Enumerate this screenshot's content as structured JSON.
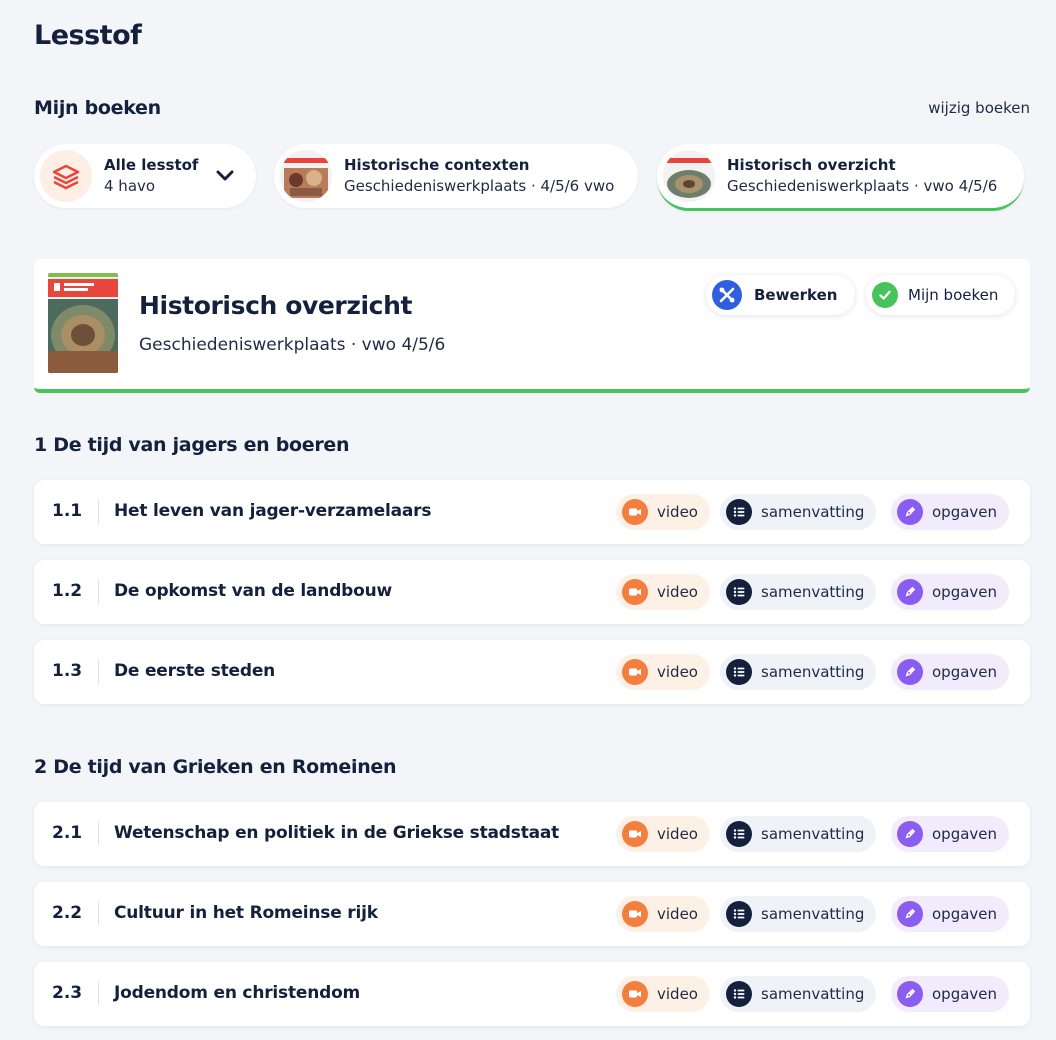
{
  "page": {
    "title": "Lesstof"
  },
  "books_section": {
    "heading": "Mijn boeken",
    "edit_link": "wijzig boeken"
  },
  "book_pills": [
    {
      "title": "Alle lesstof",
      "subtitle": "4 havo"
    },
    {
      "title": "Historische contexten",
      "subtitle": "Geschiedeniswerkplaats · 4/5/6 vwo"
    },
    {
      "title": "Historisch overzicht",
      "subtitle": "Geschiedeniswerkplaats · vwo 4/5/6",
      "active": true
    }
  ],
  "selected_book": {
    "title": "Historisch overzicht",
    "subtitle": "Geschiedeniswerkplaats · vwo 4/5/6",
    "edit_button": "Bewerken",
    "my_books_button": "Mijn boeken"
  },
  "resource_labels": {
    "video": "video",
    "summary": "samenvatting",
    "exercises": "opgaven"
  },
  "chapters": [
    {
      "title": "1 De tijd van jagers en boeren",
      "paragraphs": [
        {
          "num": "1.1",
          "title": "Het leven van jager-verzamelaars"
        },
        {
          "num": "1.2",
          "title": "De opkomst van de landbouw"
        },
        {
          "num": "1.3",
          "title": "De eerste steden"
        }
      ]
    },
    {
      "title": "2 De tijd van Grieken en Romeinen",
      "paragraphs": [
        {
          "num": "2.1",
          "title": "Wetenschap en politiek in de Griekse stadstaat"
        },
        {
          "num": "2.2",
          "title": "Cultuur in het Romeinse rijk"
        },
        {
          "num": "2.3",
          "title": "Jodendom en christendom"
        }
      ]
    }
  ],
  "colors": {
    "accent_green": "#46c35b",
    "video_orange": "#f47e40",
    "summary_navy": "#14213d",
    "exercise_purple": "#8b5cf0",
    "edit_blue": "#2f5fdc",
    "background": "#f3f5f9"
  }
}
